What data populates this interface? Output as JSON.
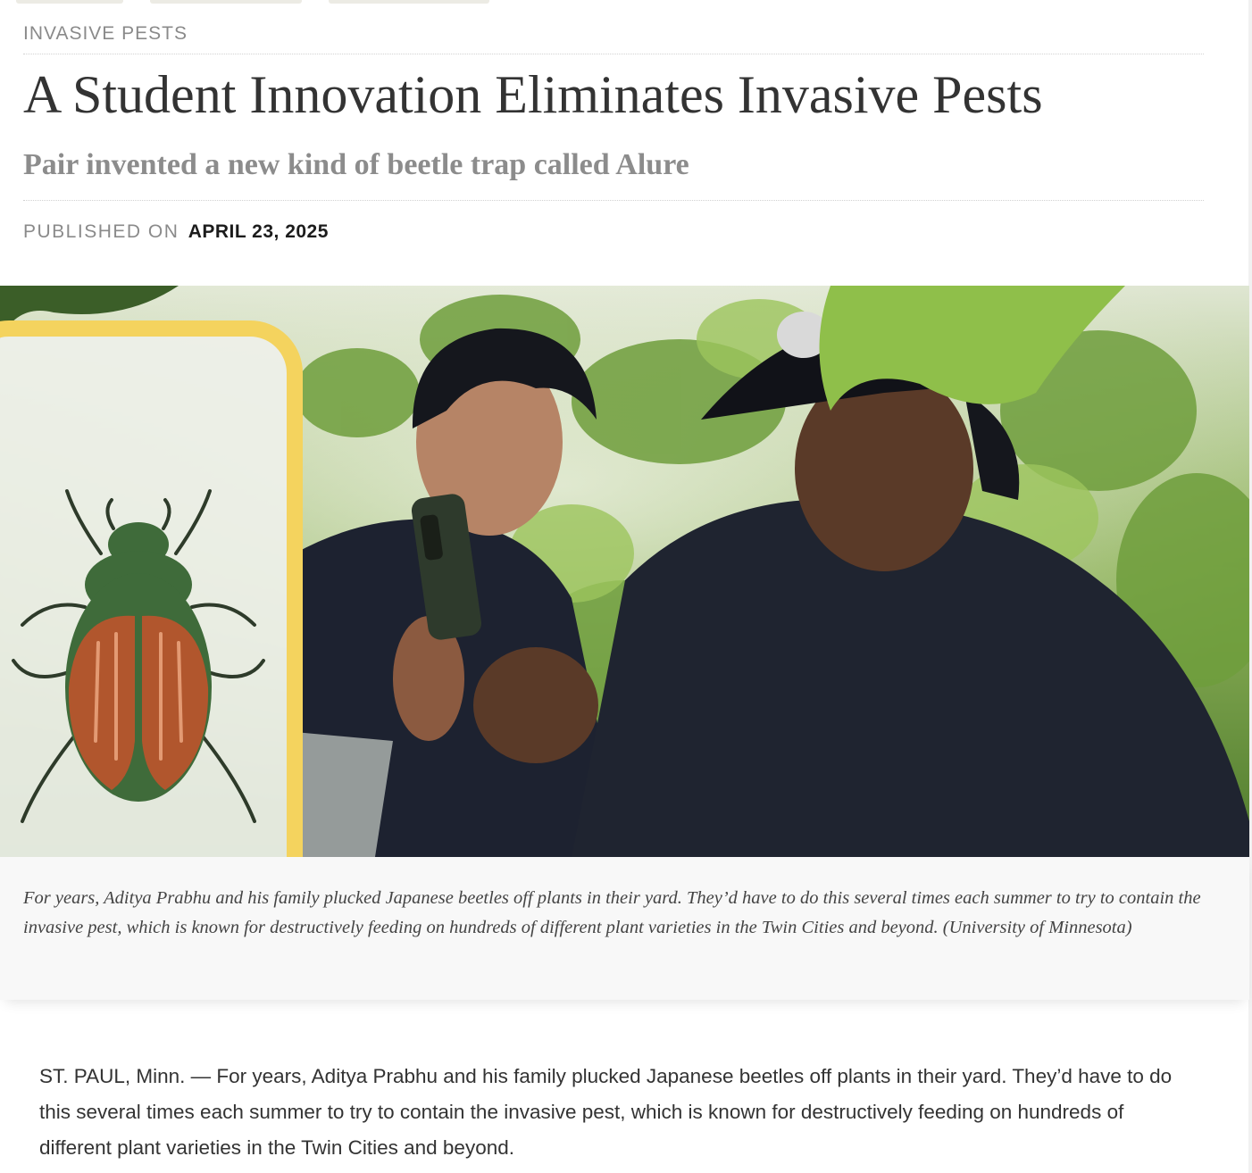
{
  "article": {
    "kicker": "INVASIVE PESTS",
    "title": "A Student Innovation Eliminates Invasive Pests",
    "subtitle": "Pair invented a new kind of beetle trap called Alure",
    "published_label": "PUBLISHED ON",
    "published_date": "APRIL 23, 2025",
    "hero_caption": "For years, Aditya Prabhu and his family plucked Japanese beetles off plants in their yard. They’d have to do this several times each summer to try to contain the invasive pest, which is known for destructively feeding on hundreds of different plant varieties in the Twin Cities and beyond. (University of Minnesota)",
    "body_paragraph": "ST. PAUL, Minn. — For years, Aditya Prabhu and his family plucked Japanese beetles off plants in their yard. They’d have to do this several times each summer to try to contain the invasive pest, which is known for destructively feeding on hundreds of different plant varieties in the Twin Cities and beyond."
  },
  "colors": {
    "frame_yellow": "#f4d35e",
    "beetle_green": "#3f6b3a",
    "beetle_wing": "#b1562d",
    "foliage": "#7fae45",
    "jacket": "#1f2430"
  },
  "icons": [
    "japanese-beetle-illustration",
    "smartphone",
    "baseball-cap"
  ]
}
